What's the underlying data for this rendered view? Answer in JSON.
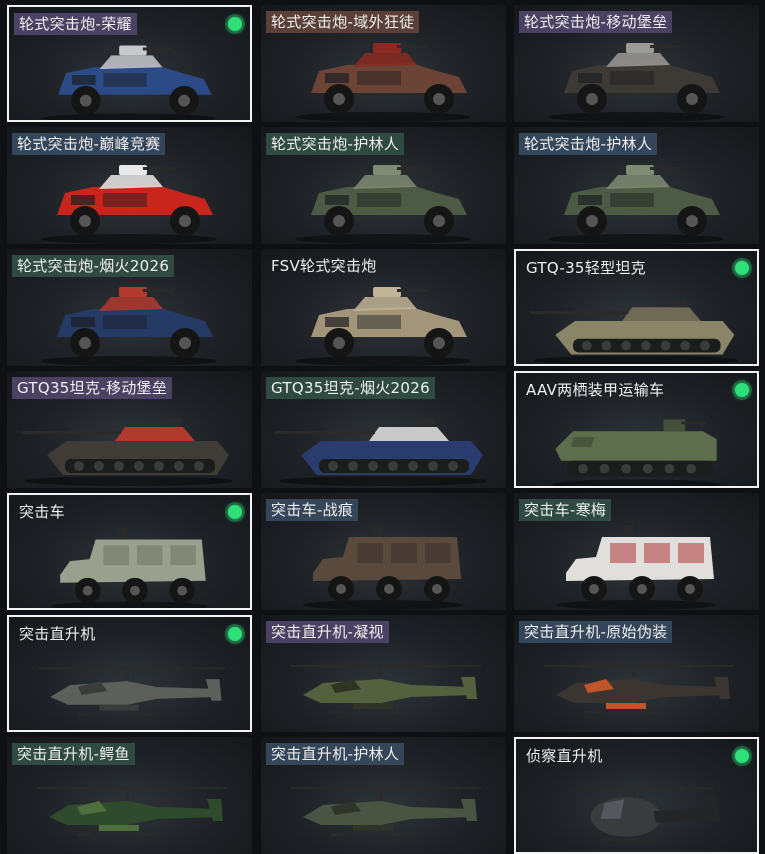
{
  "cards": [
    {
      "label": "轮式突击炮-荣耀",
      "owned": true,
      "selected": true,
      "tag": "purple",
      "vehicle": "armored-car-icon",
      "body": "#2b4a86",
      "accent": "#c7c9cc"
    },
    {
      "label": "轮式突击炮-域外狂徒",
      "owned": false,
      "selected": false,
      "tag": "brown",
      "vehicle": "armored-car-icon",
      "body": "#6b4436",
      "accent": "#8a2a22"
    },
    {
      "label": "轮式突击炮-移动堡垒",
      "owned": false,
      "selected": false,
      "tag": "purple",
      "vehicle": "armored-car-icon",
      "body": "#3d3a36",
      "accent": "#9c9a96"
    },
    {
      "label": "轮式突击炮-巅峰竞赛",
      "owned": false,
      "selected": false,
      "tag": "slate",
      "vehicle": "armored-car-icon",
      "body": "#c8261d",
      "accent": "#e9e9e9"
    },
    {
      "label": "轮式突击炮-护林人",
      "owned": false,
      "selected": false,
      "tag": "green",
      "vehicle": "armored-car-icon",
      "body": "#4d5a46",
      "accent": "#7f8b72"
    },
    {
      "label": "轮式突击炮-护林人",
      "owned": false,
      "selected": false,
      "tag": "slate",
      "vehicle": "armored-car-icon",
      "body": "#4d5a46",
      "accent": "#7f8b72"
    },
    {
      "label": "轮式突击炮-烟火2026",
      "owned": false,
      "selected": false,
      "tag": "green",
      "vehicle": "armored-car-icon",
      "body": "#263a66",
      "accent": "#b23a2e"
    },
    {
      "label": "FSV轮式突击炮",
      "owned": false,
      "selected": false,
      "tag": "none",
      "vehicle": "armored-car-icon",
      "body": "#a3957a",
      "accent": "#c1b396"
    },
    {
      "label": "GTQ-35轻型坦克",
      "owned": true,
      "selected": true,
      "tag": "none",
      "vehicle": "tank-icon",
      "body": "#8a8468",
      "accent": "#6f6a55"
    },
    {
      "label": "GTQ35坦克-移动堡垒",
      "owned": false,
      "selected": false,
      "tag": "purple",
      "vehicle": "tank-icon",
      "body": "#3f3b36",
      "accent": "#b03a2c"
    },
    {
      "label": "GTQ35坦克-烟火2026",
      "owned": false,
      "selected": false,
      "tag": "green",
      "vehicle": "tank-icon",
      "body": "#2a3b6e",
      "accent": "#c9c9c9"
    },
    {
      "label": "AAV两栖装甲运输车",
      "owned": true,
      "selected": true,
      "tag": "none",
      "vehicle": "amphibious-vehicle-icon",
      "body": "#5e6e4c",
      "accent": "#454f39"
    },
    {
      "label": "突击车",
      "owned": true,
      "selected": true,
      "tag": "none",
      "vehicle": "assault-truck-icon",
      "body": "#9aa08e",
      "accent": "#6f7564"
    },
    {
      "label": "突击车-战痕",
      "owned": false,
      "selected": false,
      "tag": "slate",
      "vehicle": "assault-truck-icon",
      "body": "#5a4a3e",
      "accent": "#3b3029"
    },
    {
      "label": "突击车-寒梅",
      "owned": false,
      "selected": false,
      "tag": "green",
      "vehicle": "assault-truck-icon",
      "body": "#e0dfdc",
      "accent": "#b0363a"
    },
    {
      "label": "突击直升机",
      "owned": true,
      "selected": true,
      "tag": "none",
      "vehicle": "attack-helicopter-icon",
      "body": "#5c5f5a",
      "accent": "#3a3c39"
    },
    {
      "label": "突击直升机-凝视",
      "owned": false,
      "selected": false,
      "tag": "purple",
      "vehicle": "attack-helicopter-icon",
      "body": "#55603e",
      "accent": "#2f3425"
    },
    {
      "label": "突击直升机-原始伪装",
      "owned": false,
      "selected": false,
      "tag": "slate",
      "vehicle": "attack-helicopter-icon",
      "body": "#3a3530",
      "accent": "#c0542a"
    },
    {
      "label": "突击直升机-鳄鱼",
      "owned": false,
      "selected": false,
      "tag": "green",
      "vehicle": "attack-helicopter-icon",
      "body": "#2f4a2c",
      "accent": "#4f6e3e"
    },
    {
      "label": "突击直升机-护林人",
      "owned": false,
      "selected": false,
      "tag": "slate",
      "vehicle": "attack-helicopter-icon",
      "body": "#4a5442",
      "accent": "#2e3429"
    },
    {
      "label": "侦察直升机",
      "owned": true,
      "selected": true,
      "tag": "none",
      "vehicle": "scout-helicopter-icon",
      "body": "#3a3b3c",
      "accent": "#242526"
    }
  ]
}
